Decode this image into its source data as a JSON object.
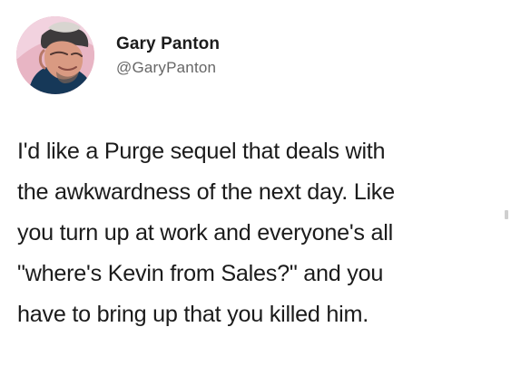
{
  "author": {
    "display_name": "Gary Panton",
    "handle": "@GaryPanton",
    "avatar_icon": "profile-photo-avatar"
  },
  "tweet": {
    "lines": [
      "I'd like a Purge sequel that deals with",
      "the awkwardness of the next day. Like",
      "you turn up at work and everyone's all",
      "\"where's Kevin from Sales?\" and you",
      "have to bring up that you killed him."
    ]
  },
  "colors": {
    "background": "#ffffff",
    "text": "#1b1b1b",
    "handle": "#666666",
    "avatar_background": "#e9b7c7"
  }
}
